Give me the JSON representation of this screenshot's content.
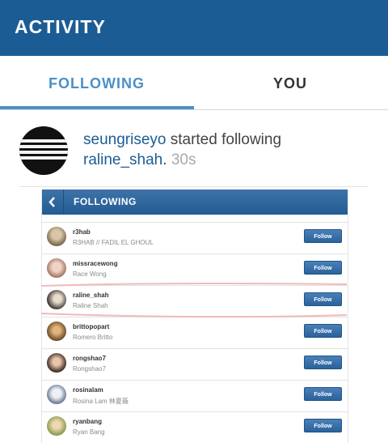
{
  "header": {
    "title": "ACTIVITY"
  },
  "tabs": [
    {
      "label": "FOLLOWING",
      "active": true
    },
    {
      "label": "YOU",
      "active": false
    }
  ],
  "activity": {
    "actor": "seungriseyo",
    "action": " started following",
    "target": "raline_shah",
    "separator": ".",
    "time": "30s"
  },
  "screenshot": {
    "title": "FOLLOWING",
    "button_label": "Follow",
    "highlight_color": "#f2b8bf",
    "rows": [
      {
        "username": "r3hab",
        "full_name": "R3HAB // FADIL EL GHOUL"
      },
      {
        "username": "missracewong",
        "full_name": "Race Wong"
      },
      {
        "username": "raline_shah",
        "full_name": "Raline Shah"
      },
      {
        "username": "brittopopart",
        "full_name": "Romero Britto"
      },
      {
        "username": "rongshao7",
        "full_name": "Rongshao7"
      },
      {
        "username": "rosinalam",
        "full_name": "Rosina Lam 林夏薇"
      },
      {
        "username": "ryanbang",
        "full_name": "Ryan Bang"
      }
    ]
  },
  "colors": {
    "header_bg": "#1c5c94",
    "tab_active": "#4a90c8",
    "username": "#1c5c94",
    "follow_button": "#2b629c"
  }
}
